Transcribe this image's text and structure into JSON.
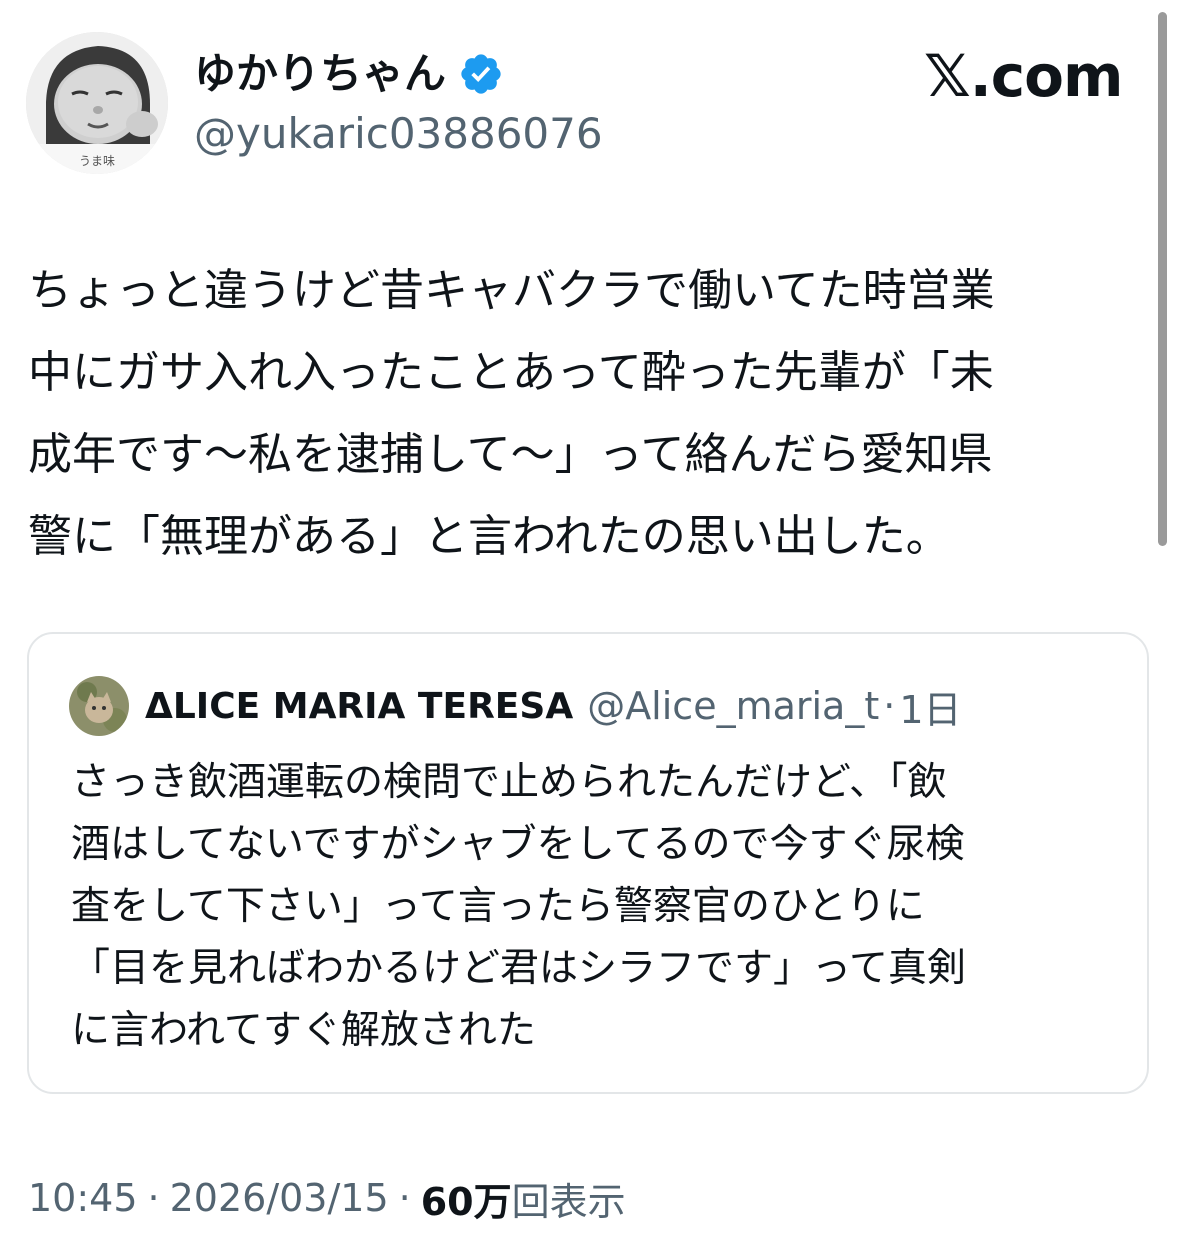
{
  "author": {
    "display_name": "ゆかりちゃん",
    "handle": "@yukaric03886076",
    "avatar_caption": "うま味",
    "verified_badge_color": "#1d9bf0"
  },
  "brand": {
    "text": "𝕏.com"
  },
  "tweet": {
    "lines": [
      "ちょっと違うけど昔キャバクラで働いてた時営業",
      "中にガサ入れ入ったことあって酔った先輩が「未",
      "成年です〜私を逮捕して〜」って絡んだら愛知県",
      "警に「無理がある」と言われたの思い出した。"
    ]
  },
  "quoted_tweet": {
    "author_name": "ΔLICE MARIA TERESA",
    "handle": "@Alice_maria_t",
    "separator": "·",
    "time": "1日",
    "lines": [
      "さっき飲酒運転の検問で止められたんだけど、「飲",
      "酒はしてないですがシャブをしてるので今すぐ尿検",
      "査をして下さい」って言ったら警察官のひとりに",
      "「目を見ればわかるけど君はシラフです」って真剣",
      "に言われてすぐ解放された"
    ]
  },
  "meta": {
    "time": "10:45",
    "separator": "·",
    "date": "2026/03/15",
    "views_count": "60万",
    "views_label": "回表示"
  },
  "colors": {
    "text_primary": "#0f1419",
    "text_secondary": "#536471",
    "border": "#e3e6e8"
  }
}
